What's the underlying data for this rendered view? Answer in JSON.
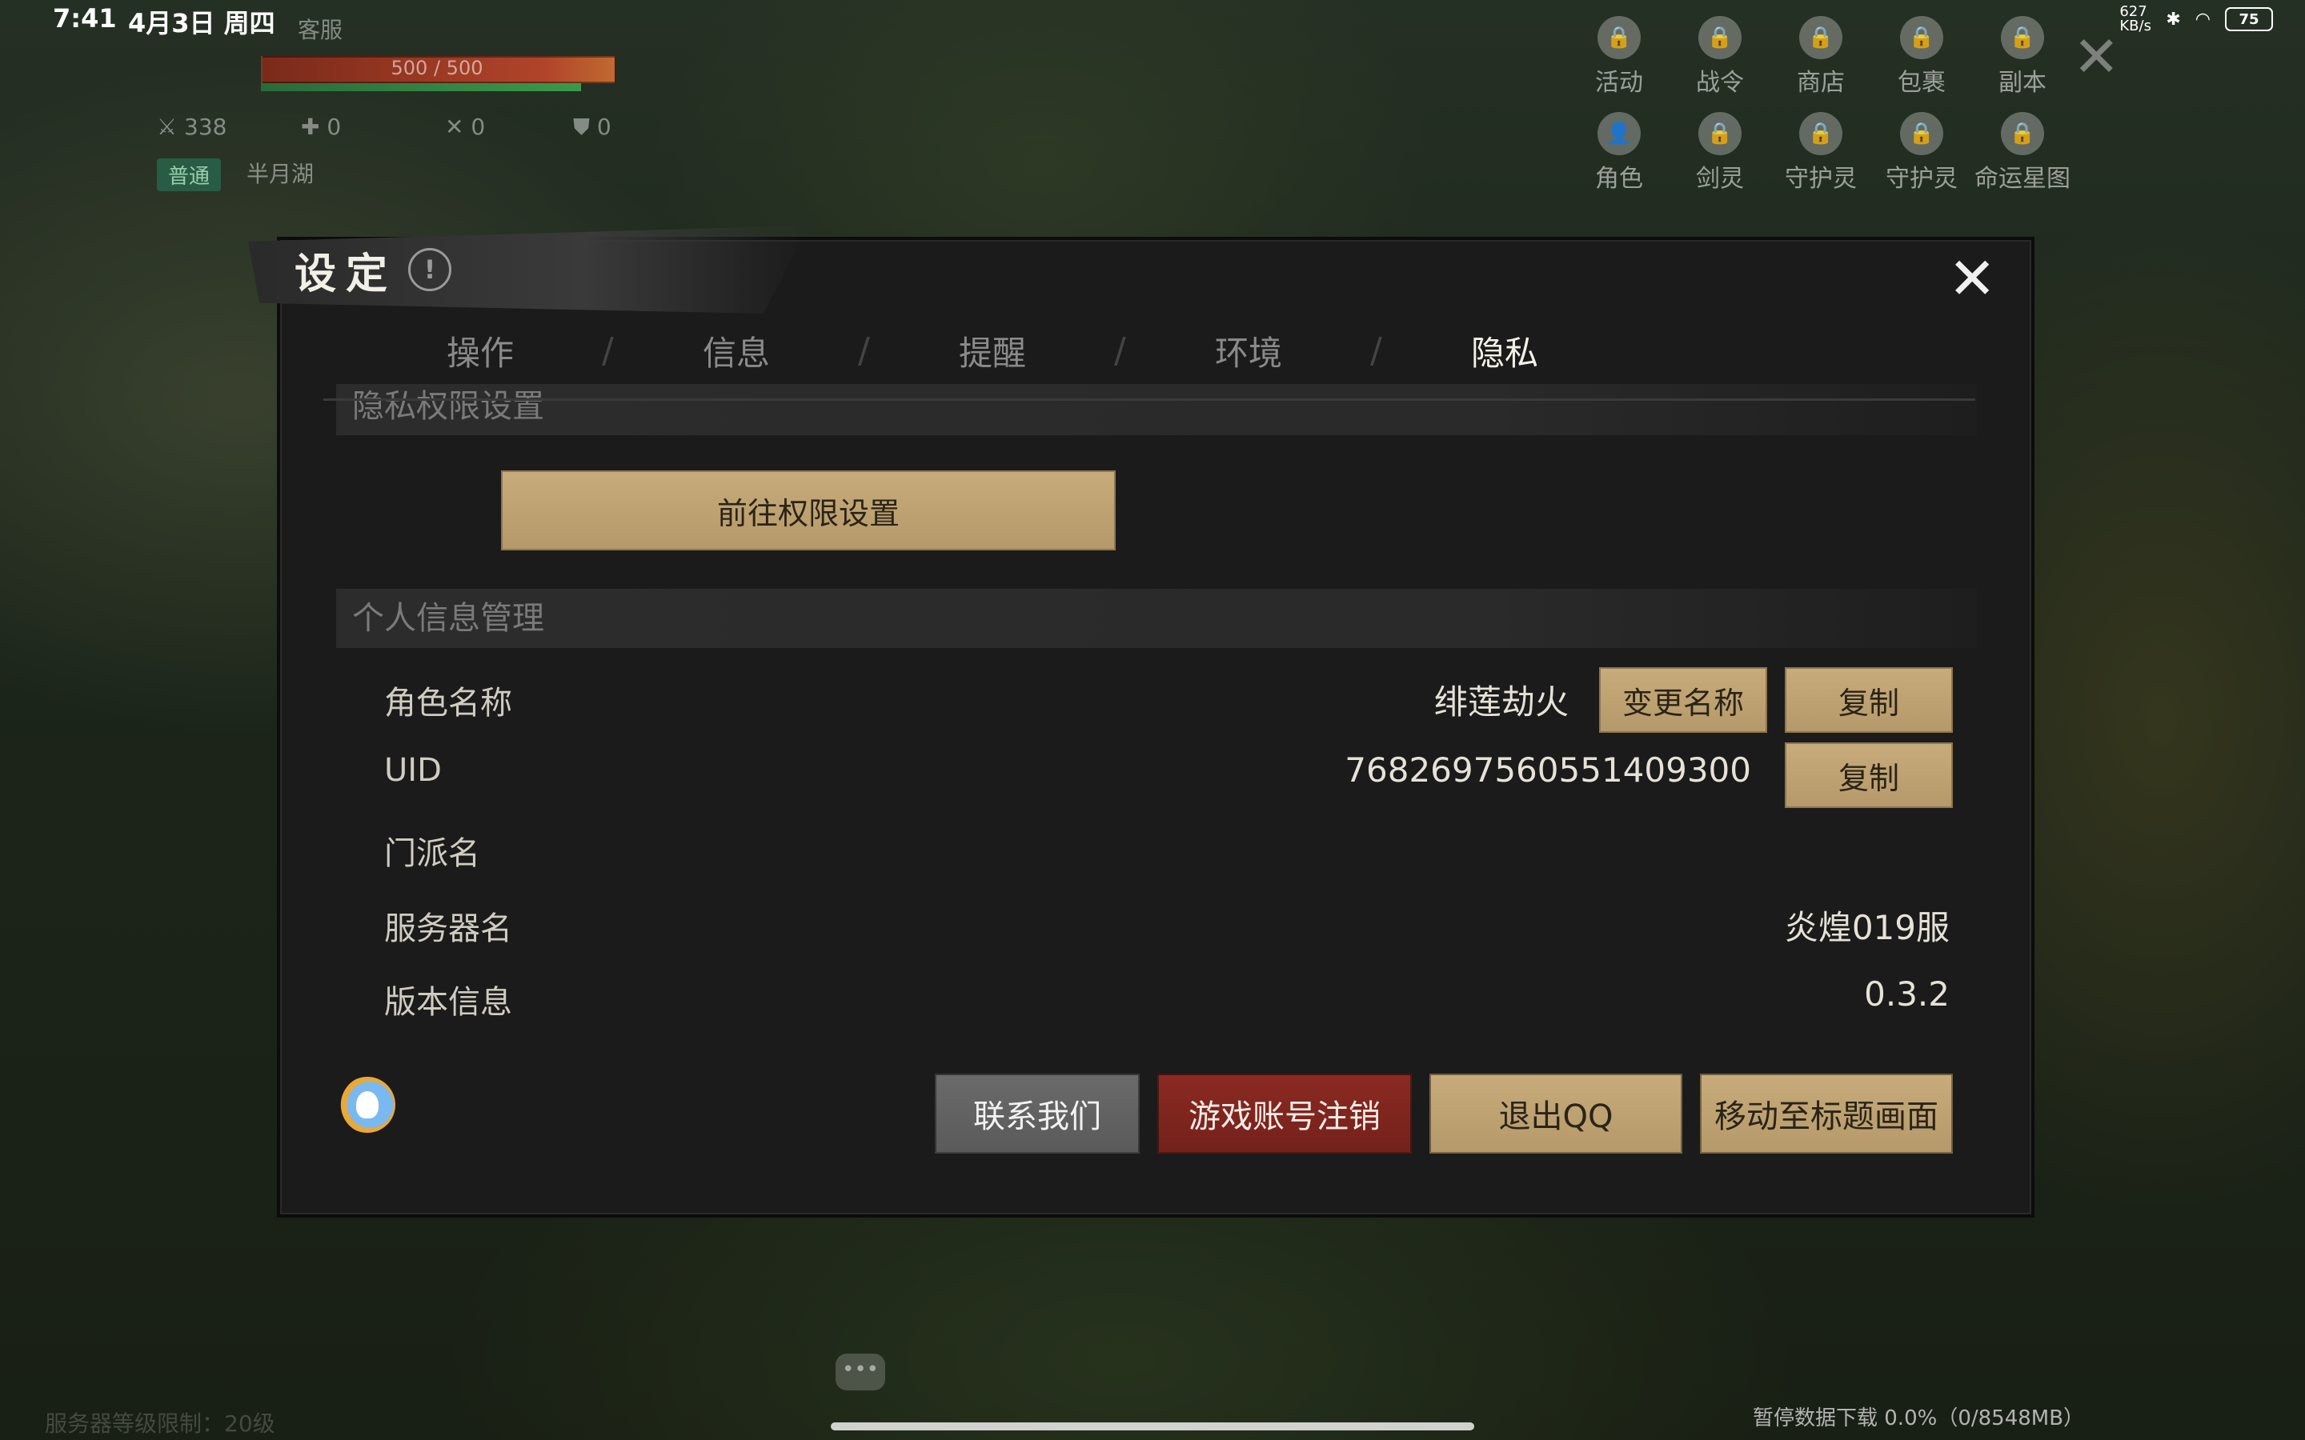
{
  "status_bar": {
    "time": "7:41",
    "date": "4月3日 周四",
    "net_speed": "627 KB/s",
    "battery": "75"
  },
  "hud": {
    "server_tag": "客服",
    "hp_text": "500 / 500",
    "stat_1": "338",
    "stat_2": "0",
    "stat_3": "0",
    "stat_4": "0",
    "mode": "普通",
    "location": "半月湖"
  },
  "top_menu": {
    "row1": [
      {
        "label": "活动",
        "icon": "lock-icon"
      },
      {
        "label": "战令",
        "icon": "lock-icon"
      },
      {
        "label": "商店",
        "icon": "lock-icon"
      },
      {
        "label": "包裹",
        "icon": "lock-icon"
      },
      {
        "label": "副本",
        "icon": "lock-icon"
      }
    ],
    "row2": [
      {
        "label": "角色",
        "icon": "character-icon"
      },
      {
        "label": "剑灵",
        "icon": "lock-icon"
      },
      {
        "label": "守护灵",
        "icon": "lock-icon"
      },
      {
        "label": "守护灵",
        "icon": "lock-icon"
      },
      {
        "label": "命运星图",
        "icon": "lock-icon"
      }
    ]
  },
  "dialog": {
    "title": "设定",
    "tabs": [
      "操作",
      "信息",
      "提醒",
      "环境",
      "隐私"
    ],
    "active_tab": "隐私",
    "section_privacy": "隐私权限设置",
    "permission_button": "前往权限设置",
    "section_personal": "个人信息管理",
    "rows": {
      "role_name_label": "角色名称",
      "role_name_value": "绯莲劫火",
      "rename_button": "变更名称",
      "copy_button": "复制",
      "uid_label": "UID",
      "uid_value": "7682697560551409300",
      "copy_uid_button": "复制",
      "sect_label": "门派名",
      "server_label": "服务器名",
      "server_value": "炎煌019服",
      "version_label": "版本信息",
      "version_value": "0.3.2"
    },
    "buttons": {
      "contact": "联系我们",
      "cancel_account": "游戏账号注销",
      "logout_qq": "退出QQ",
      "to_title": "移动至标题画面"
    }
  },
  "footer": {
    "download_status": "暂停数据下载 0.0%（0/8548MB）",
    "server_level": "服务器等级限制：20级"
  },
  "colors": {
    "gold_button": "#c2a574",
    "red_button": "#7f261f",
    "gray_button": "#626262",
    "dialog_bg": "#1b1b1b"
  }
}
